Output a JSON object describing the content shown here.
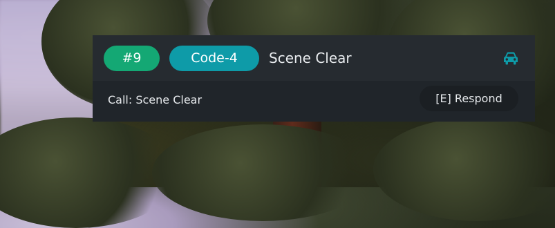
{
  "notification": {
    "id_badge": "#9",
    "code_badge": "Code-4",
    "title": "Scene Clear",
    "call_label": "Call: Scene Clear",
    "respond_button": "[E] Respond",
    "vehicle_icon": "car-icon"
  },
  "colors": {
    "id_badge_bg": "#14a874",
    "code_badge_bg": "#0e9ba8",
    "vehicle_icon": "#0e9ba8",
    "panel_bg": "#262b30"
  }
}
